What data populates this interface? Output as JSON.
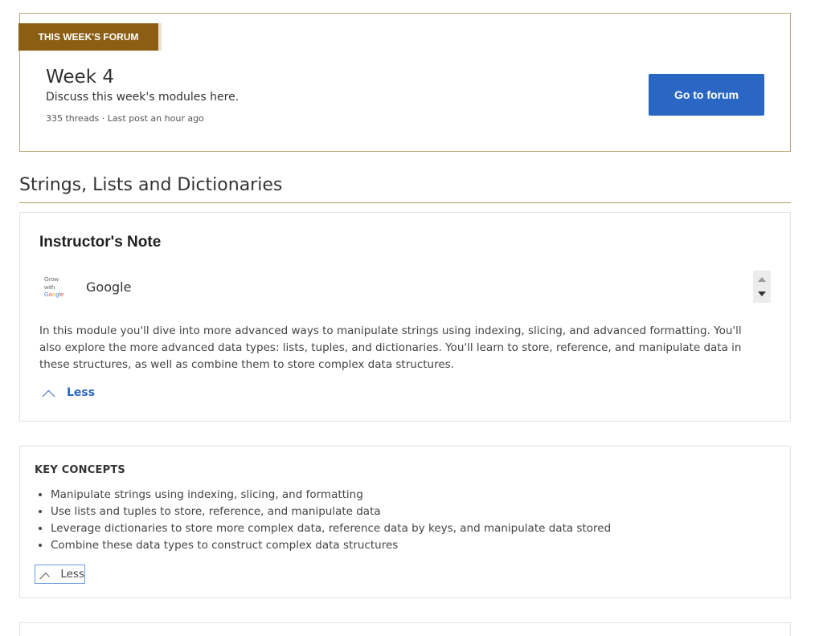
{
  "forum": {
    "badge": "THIS WEEK'S FORUM",
    "title": "Week 4",
    "description": "Discuss this week's modules here.",
    "meta": "335 threads · Last post an hour ago",
    "button_label": "Go to forum"
  },
  "section": {
    "title": "Strings, Lists and Dictionaries"
  },
  "instructor_note": {
    "heading": "Instructor's Note",
    "logo_lines": [
      "Grow",
      "with"
    ],
    "logo_word": [
      "G",
      "o",
      "o",
      "g",
      "l",
      "e"
    ],
    "instructor_name": "Google",
    "body": "In this module you'll dive into more advanced ways to manipulate strings using indexing, slicing, and advanced formatting. You'll also explore the more advanced data types: lists, tuples, and dictionaries. You'll learn to store, reference, and manipulate data in these structures, as well as combine them to store complex data structures.",
    "less_label": "Less"
  },
  "key_concepts": {
    "heading": "KEY CONCEPTS",
    "items": [
      "Manipulate strings using indexing, slicing, and formatting",
      "Use lists and tuples to store, reference, and manipulate data",
      "Leverage dictionaries to store more complex data, reference data by keys, and manipulate data stored",
      "Combine these data types to construct complex data structures"
    ],
    "less_label": "Less"
  },
  "colors": {
    "ribbon": "#8b5e13",
    "primary_button": "#2a67c4",
    "link": "#2a67c4",
    "section_rule": "#b39b63"
  }
}
